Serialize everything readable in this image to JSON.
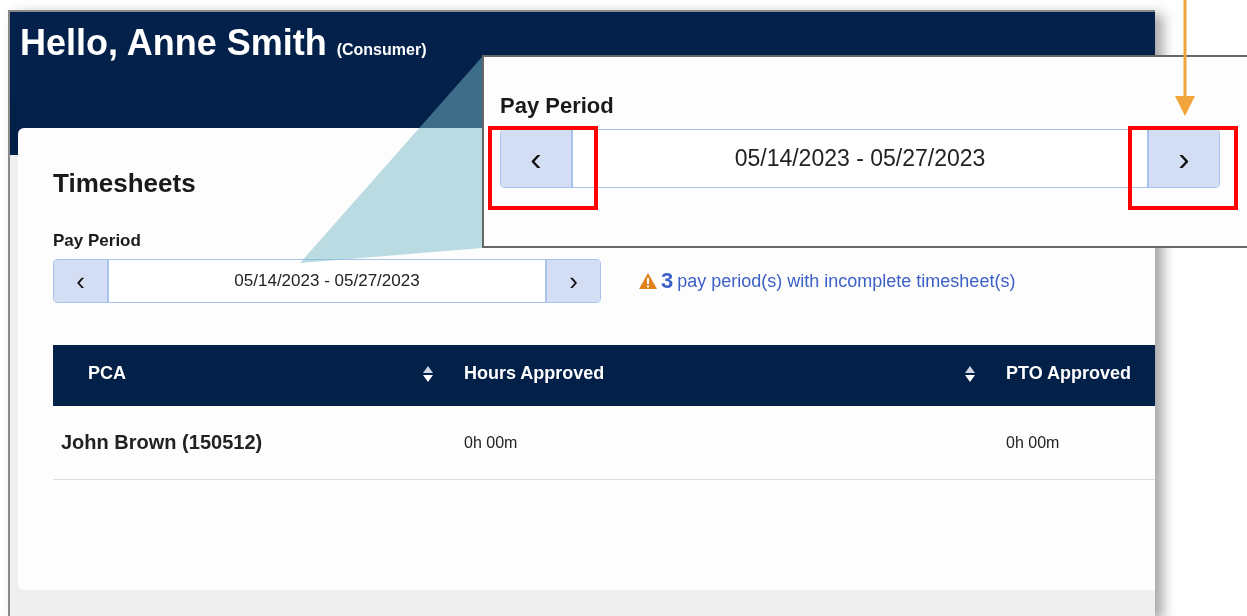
{
  "header": {
    "greeting": "Hello, Anne Smith",
    "role": "(Consumer)"
  },
  "card": {
    "title": "Timesheets",
    "pay_period_label": "Pay Period",
    "pay_period": {
      "prev": "‹",
      "value": "05/14/2023 - 05/27/2023",
      "next": "›"
    },
    "warning": {
      "count": "3",
      "text": "pay period(s) with incomplete timesheet(s)"
    }
  },
  "table": {
    "columns": [
      {
        "label": "PCA",
        "sortable": true
      },
      {
        "label": "Hours Approved",
        "sortable": true
      },
      {
        "label": "PTO Approved",
        "sortable": false
      }
    ],
    "rows": [
      {
        "cells": [
          "John Brown (150512)",
          "0h 00m",
          "0h 00m"
        ]
      }
    ]
  },
  "callout": {
    "label": "Pay Period",
    "prev": "‹",
    "value": "05/14/2023 - 05/27/2023",
    "next": "›",
    "prev_highlighted": true,
    "next_highlighted": true,
    "next_arrow": true
  }
}
